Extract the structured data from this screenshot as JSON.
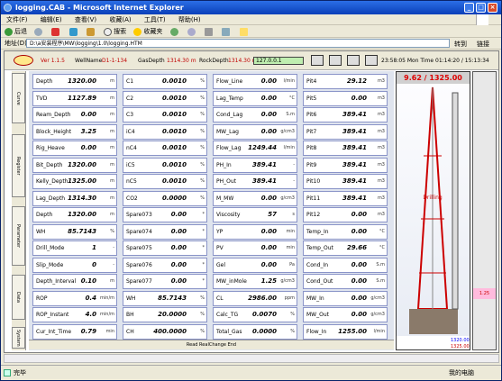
{
  "window": {
    "title": "logging.CAB - Microsoft Internet Explorer"
  },
  "menu": [
    "文件(F)",
    "编辑(E)",
    "查看(V)",
    "收藏(A)",
    "工具(T)",
    "帮助(H)"
  ],
  "toolbar": {
    "back": "后退",
    "search": "搜索",
    "favorites": "收藏夹"
  },
  "address": {
    "label": "地址(D)",
    "value": "D:\\a安装程序\\MW\\logging\\1.0\\logging.HTM",
    "go": "转到",
    "links": "链接"
  },
  "header": {
    "version": "Ver 1.1.5",
    "wellname_label": "WellName",
    "wellname": "D1-1-134",
    "gasdepth_label": "GasDepth",
    "gasdepth": "1314.30 m",
    "rockdepth_label": "RockDepth",
    "rockdepth": "1314.30 m",
    "message": "127.0.0.1",
    "datetime": "23:58:05 Mon Time 01:14:20 / 15:13:34"
  },
  "side_tabs": [
    "Curve",
    "Register",
    "Parameter",
    "Data",
    "System"
  ],
  "params": [
    [
      {
        "n": "Depth",
        "v": "1320.00",
        "u": "m"
      },
      {
        "n": "TVD",
        "v": "1127.89",
        "u": "m"
      },
      {
        "n": "Ream_Depth",
        "v": "0.00",
        "u": "m"
      },
      {
        "n": "Block_Height",
        "v": "3.25",
        "u": "m"
      },
      {
        "n": "Rig_Heave",
        "v": "0.00",
        "u": "m"
      },
      {
        "n": "Bit_Depth",
        "v": "1320.00",
        "u": "m"
      },
      {
        "n": "Kelly_Depth",
        "v": "1325.00",
        "u": "m"
      },
      {
        "n": "Lag_Depth",
        "v": "1314.30",
        "u": "m"
      },
      {
        "n": "Depth",
        "v": "1320.00",
        "u": "m"
      },
      {
        "n": "WH",
        "v": "85.7143",
        "u": "%"
      },
      {
        "n": "Drill_Mode",
        "v": "1",
        "u": "-"
      },
      {
        "n": "Slip_Mode",
        "v": "0",
        "u": "-"
      },
      {
        "n": "Depth_Interval",
        "v": "0.10",
        "u": "m"
      },
      {
        "n": "ROP",
        "v": "0.4",
        "u": "min/m"
      },
      {
        "n": "ROP_Instant",
        "v": "4.0",
        "u": "min/m"
      },
      {
        "n": "Cur_Int_Time",
        "v": "0.79",
        "u": "min"
      }
    ],
    [
      {
        "n": "C1",
        "v": "0.0010",
        "u": "%"
      },
      {
        "n": "C2",
        "v": "0.0010",
        "u": "%"
      },
      {
        "n": "C3",
        "v": "0.0010",
        "u": "%"
      },
      {
        "n": "iC4",
        "v": "0.0010",
        "u": "%"
      },
      {
        "n": "nC4",
        "v": "0.0010",
        "u": "%"
      },
      {
        "n": "iC5",
        "v": "0.0010",
        "u": "%"
      },
      {
        "n": "nC5",
        "v": "0.0010",
        "u": "%"
      },
      {
        "n": "CO2",
        "v": "0.0000",
        "u": "%"
      },
      {
        "n": "Spare073",
        "v": "0.00",
        "u": "*"
      },
      {
        "n": "Spare074",
        "v": "0.00",
        "u": "*"
      },
      {
        "n": "Spare075",
        "v": "0.00",
        "u": "*"
      },
      {
        "n": "Spare076",
        "v": "0.00",
        "u": "*"
      },
      {
        "n": "Spare077",
        "v": "0.00",
        "u": "*"
      },
      {
        "n": "WH",
        "v": "85.7143",
        "u": "%"
      },
      {
        "n": "BH",
        "v": "20.0000",
        "u": "%"
      },
      {
        "n": "CH",
        "v": "400.0000",
        "u": "%"
      }
    ],
    [
      {
        "n": "Flow_Line",
        "v": "0.00",
        "u": "l/min"
      },
      {
        "n": "Lag_Temp",
        "v": "0.00",
        "u": "°C"
      },
      {
        "n": "Cond_Lag",
        "v": "0.00",
        "u": "S.m"
      },
      {
        "n": "MW_Lag",
        "v": "0.00",
        "u": "g/cm3"
      },
      {
        "n": "Flow_Lag",
        "v": "1249.44",
        "u": "l/min"
      },
      {
        "n": "PH_In",
        "v": "389.41",
        "u": "-"
      },
      {
        "n": "PH_Out",
        "v": "389.41",
        "u": "-"
      },
      {
        "n": "M_MW",
        "v": "0.00",
        "u": "g/cm3"
      },
      {
        "n": "Viscosity",
        "v": "57",
        "u": "s"
      },
      {
        "n": "YP",
        "v": "0.00",
        "u": "min"
      },
      {
        "n": "PV",
        "v": "0.00",
        "u": "min"
      },
      {
        "n": "Gel",
        "v": "0.00",
        "u": "Pa"
      },
      {
        "n": "MW_inMole",
        "v": "1.25",
        "u": "g/cm3"
      },
      {
        "n": "CL",
        "v": "2986.00",
        "u": "ppm"
      },
      {
        "n": "Calc_TG",
        "v": "0.0070",
        "u": "%"
      },
      {
        "n": "Total_Gas",
        "v": "0.0000",
        "u": "%"
      }
    ],
    [
      {
        "n": "Pit4",
        "v": "29.12",
        "u": "m3"
      },
      {
        "n": "Pit5",
        "v": "0.00",
        "u": "m3"
      },
      {
        "n": "Pit6",
        "v": "389.41",
        "u": "m3"
      },
      {
        "n": "Pit7",
        "v": "389.41",
        "u": "m3"
      },
      {
        "n": "Pit8",
        "v": "389.41",
        "u": "m3"
      },
      {
        "n": "Pit9",
        "v": "389.41",
        "u": "m3"
      },
      {
        "n": "Pit10",
        "v": "389.41",
        "u": "m3"
      },
      {
        "n": "Pit11",
        "v": "389.41",
        "u": "m3"
      },
      {
        "n": "Pit12",
        "v": "0.00",
        "u": "m3"
      },
      {
        "n": "Temp_In",
        "v": "0.00",
        "u": "°C"
      },
      {
        "n": "Temp_Out",
        "v": "29.66",
        "u": "°C"
      },
      {
        "n": "Cond_In",
        "v": "0.00",
        "u": "S.m"
      },
      {
        "n": "Cond_Out",
        "v": "0.00",
        "u": "S.m"
      },
      {
        "n": "MW_In",
        "v": "0.00",
        "u": "g/cm3"
      },
      {
        "n": "MW_Out",
        "v": "0.00",
        "u": "g/cm3"
      },
      {
        "n": "Flow_In",
        "v": "1255.00",
        "u": "l/min"
      }
    ]
  ],
  "status_line": "Read RealChange End",
  "rig": {
    "reading": "9.62 / 1325.00",
    "label": "Drilling",
    "depth_a": "1320.00",
    "depth_b": "1325.00",
    "marker": "1.25"
  },
  "statusbar": {
    "left": "完毕",
    "zone": "我的电脑"
  }
}
